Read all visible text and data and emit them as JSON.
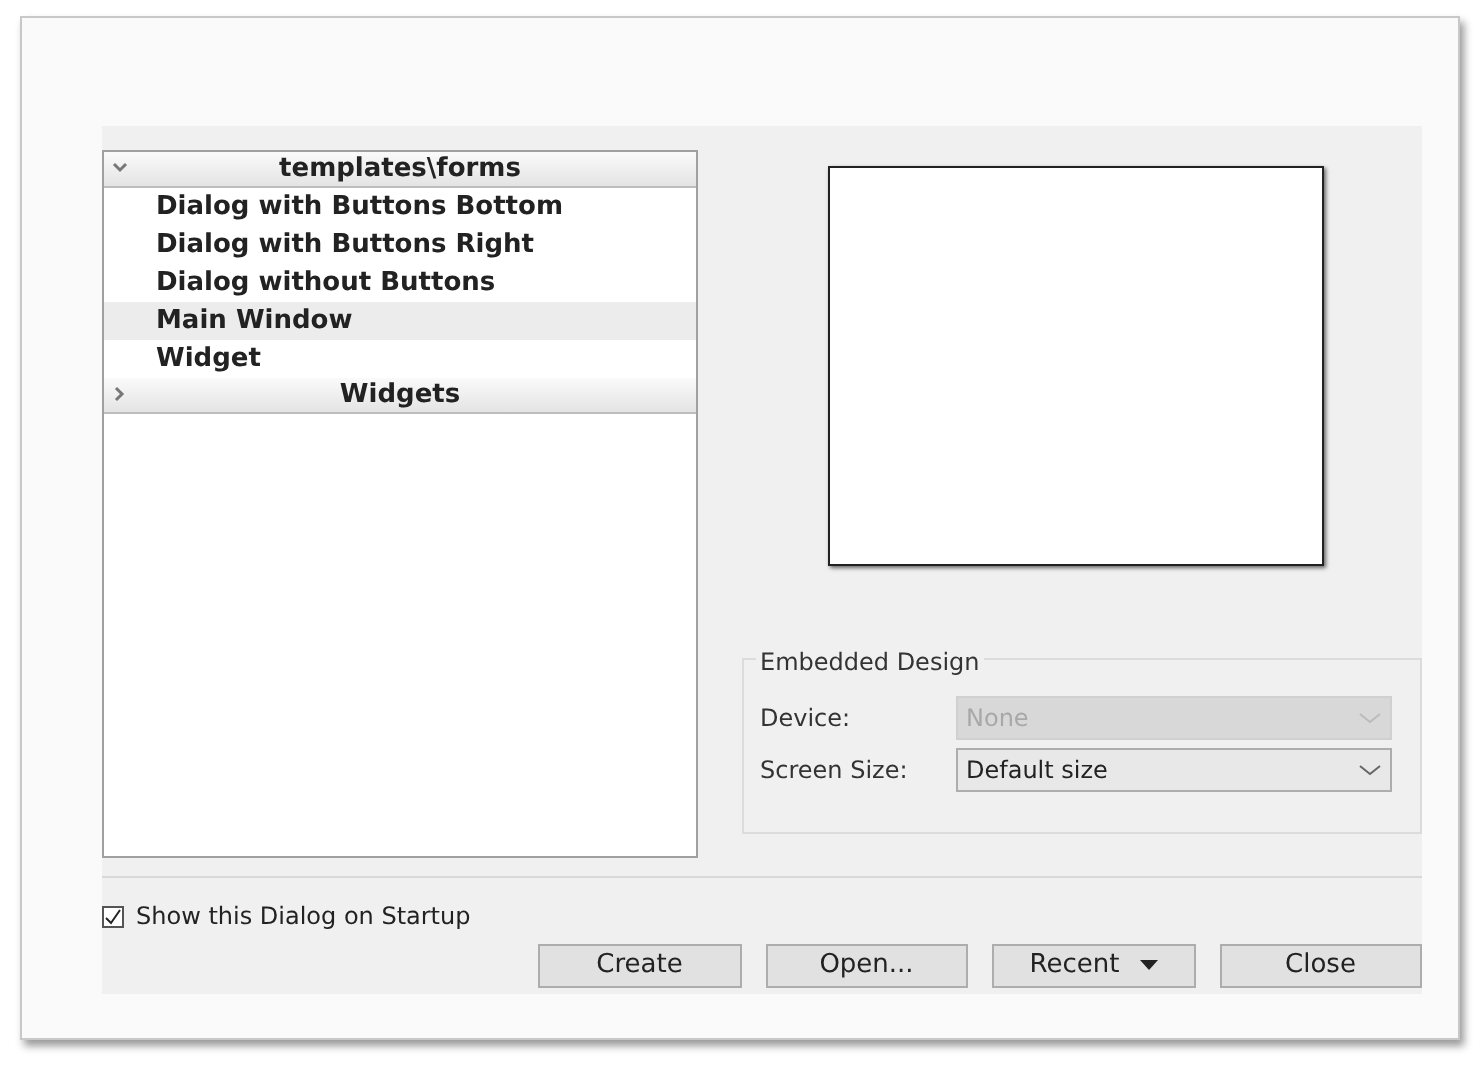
{
  "tree": [
    {
      "label": "templates\\forms",
      "expanded": true,
      "children": [
        {
          "label": "Dialog with Buttons Bottom",
          "selected": false
        },
        {
          "label": "Dialog with Buttons Right",
          "selected": false
        },
        {
          "label": "Dialog without Buttons",
          "selected": false
        },
        {
          "label": "Main Window",
          "selected": true
        },
        {
          "label": "Widget",
          "selected": false
        }
      ]
    },
    {
      "label": "Widgets",
      "expanded": false
    }
  ],
  "embedded_design": {
    "title": "Embedded Design",
    "fields": [
      {
        "label": "Device:",
        "value": "None",
        "disabled": true
      },
      {
        "label": "Screen Size:",
        "value": "Default size",
        "disabled": false
      }
    ]
  },
  "show_on_startup": {
    "label": "Show this Dialog on Startup",
    "checked": true
  },
  "buttons": [
    {
      "label": "Create",
      "kind": "plain"
    },
    {
      "label": "Open...",
      "kind": "plain"
    },
    {
      "label": "Recent",
      "kind": "menu"
    },
    {
      "label": "Close",
      "kind": "plain"
    }
  ]
}
